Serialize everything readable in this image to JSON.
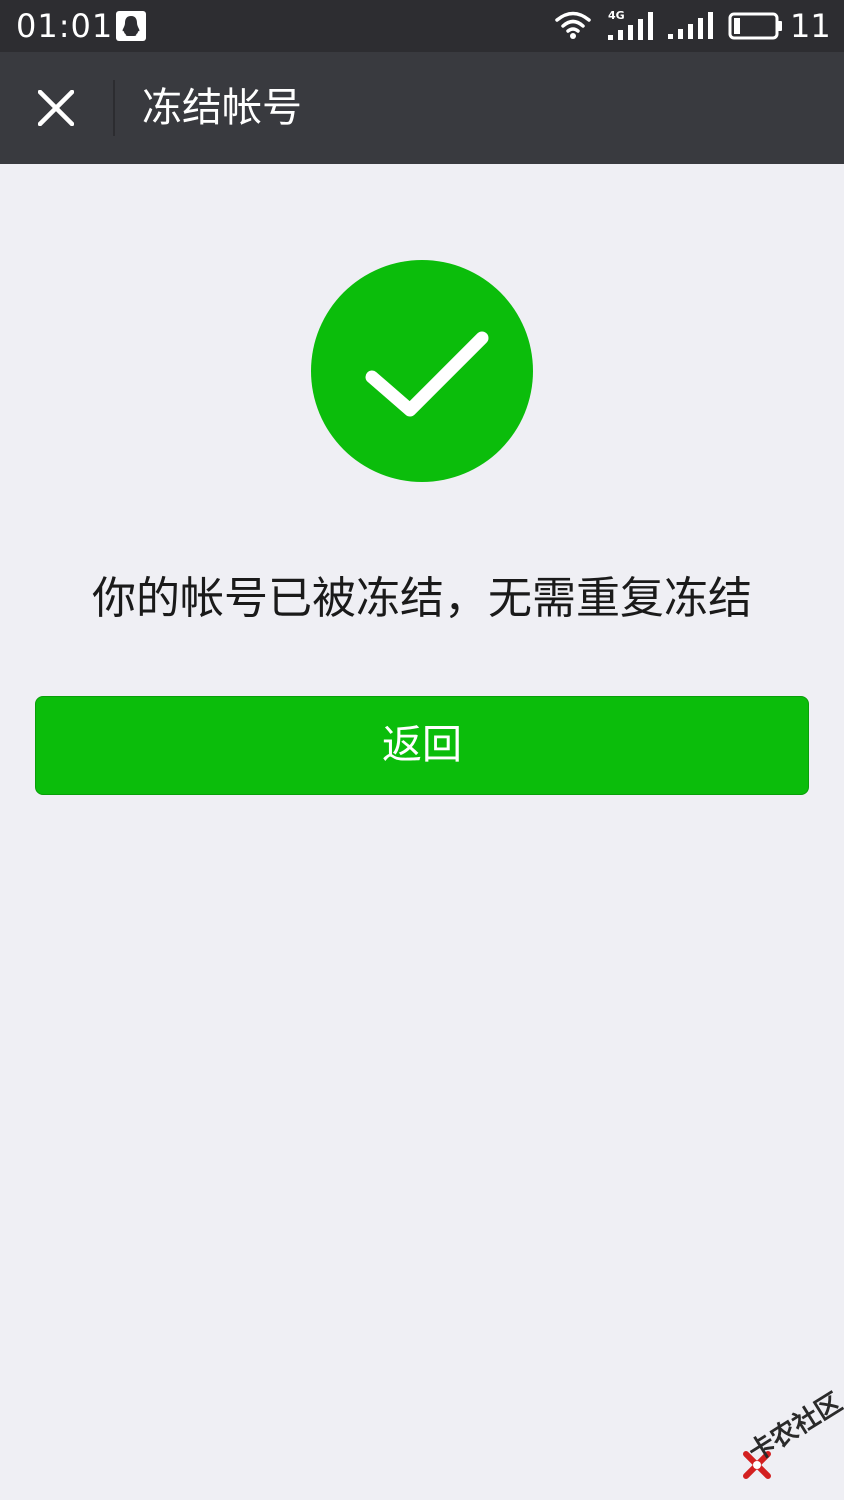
{
  "status_bar": {
    "time": "01:01",
    "network_label": "4G",
    "battery_level": "11"
  },
  "nav_bar": {
    "title": "冻结帐号"
  },
  "main": {
    "message": "你的帐号已被冻结，无需重复冻结",
    "back_label": "返回"
  },
  "watermark": {
    "text": "卡农社区"
  },
  "colors": {
    "status_bar_bg": "#2d2d31",
    "nav_bar_bg": "#393a3f",
    "page_bg": "#efeff4",
    "accent_green": "#0bbd0b",
    "text_primary": "#1a1a1a"
  },
  "icons": {
    "close": "close-icon",
    "success": "check-circle-icon",
    "qq": "qq-penguin-icon",
    "wifi": "wifi-icon",
    "signal": "signal-icon",
    "battery": "battery-icon"
  }
}
